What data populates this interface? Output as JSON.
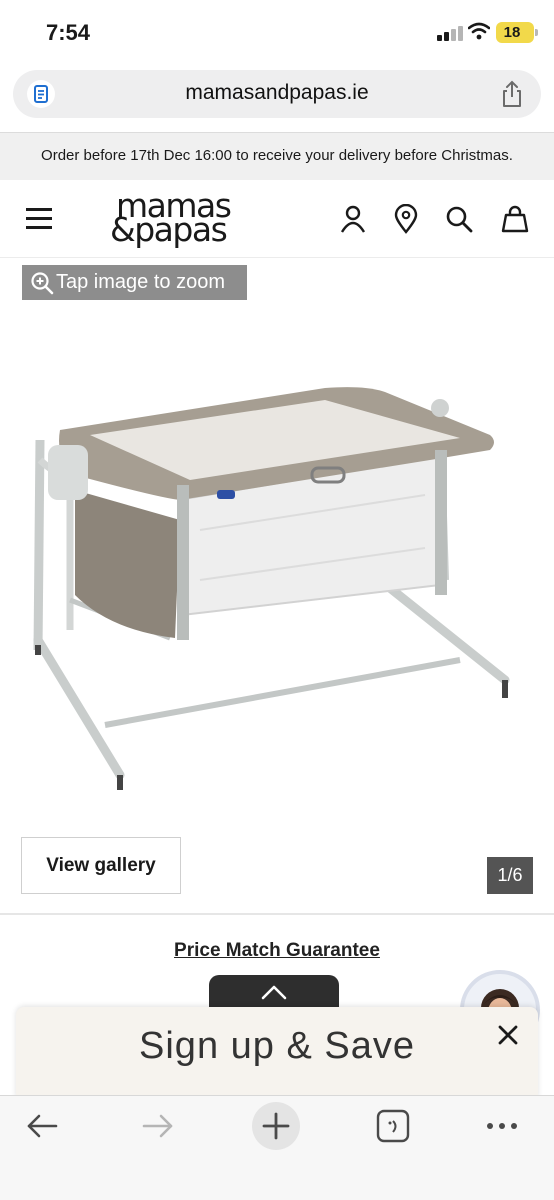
{
  "status_bar": {
    "time": "7:54",
    "battery": "18"
  },
  "browser": {
    "url": "mamasandpapas.ie"
  },
  "promo": {
    "text": "Order before 17th Dec 16:00 to receive your delivery before Christmas."
  },
  "header": {
    "logo_line1": "mamas",
    "logo_line2": "&papas"
  },
  "product": {
    "zoom_hint": "Tap image to zoom",
    "view_gallery": "View gallery",
    "image_counter": "1/6",
    "price_match": "Price Match Guarantee"
  },
  "signup": {
    "title": "Sign up & Save"
  },
  "icons": {
    "menu": "menu-icon",
    "account": "account-icon",
    "store_locator": "location-pin-icon",
    "search": "search-icon",
    "basket": "bag-icon",
    "zoom": "zoom-in-icon",
    "close": "close-icon",
    "back": "back-arrow-icon",
    "forward": "forward-arrow-icon",
    "new_tab": "plus-icon",
    "tabs": "tabs-icon",
    "more": "more-icon"
  },
  "colors": {
    "battery": "#f2d94a",
    "zoom_pill": "#8d8d8d",
    "counter": "#545454",
    "signup_panel": "#f6f3ee"
  }
}
